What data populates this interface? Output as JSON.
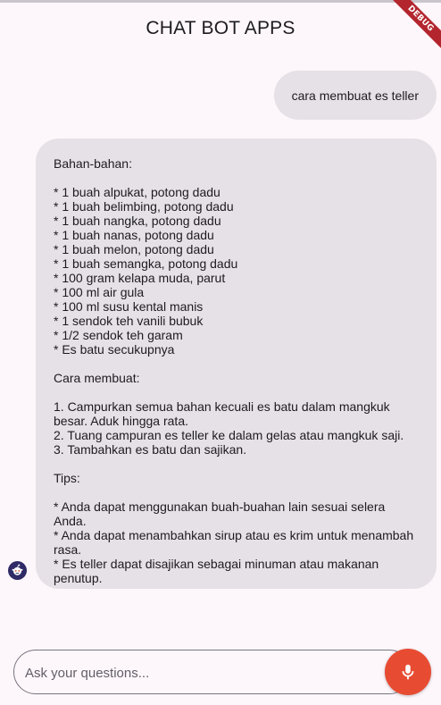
{
  "app": {
    "title": "CHAT BOT APPS",
    "debug_banner": "DEBUG"
  },
  "messages": [
    {
      "role": "user",
      "text": "cara membuat es teller"
    },
    {
      "role": "bot",
      "text": "Bahan-bahan:\n\n* 1 buah alpukat, potong dadu\n* 1 buah belimbing, potong dadu\n* 1 buah nangka, potong dadu\n* 1 buah nanas, potong dadu\n* 1 buah melon, potong dadu\n* 1 buah semangka, potong dadu\n* 100 gram kelapa muda, parut\n* 100 ml air gula\n* 100 ml susu kental manis\n* 1 sendok teh vanili bubuk\n* 1/2 sendok teh garam\n* Es batu secukupnya\n\nCara membuat:\n\n1. Campurkan semua bahan kecuali es batu dalam mangkuk\nbesar. Aduk hingga rata.\n2. Tuang campuran es teller ke dalam gelas atau mangkuk saji.\n3. Tambahkan es batu dan sajikan.\n\nTips:\n\n* Anda dapat menggunakan buah-buahan lain sesuai selera Anda.\n* Anda dapat menambahkan sirup atau es krim untuk menambah\nrasa.\n* Es teller dapat disajikan sebagai minuman atau makanan\npenutup."
    }
  ],
  "composer": {
    "placeholder": "Ask your questions...",
    "value": ""
  },
  "icons": {
    "bot_avatar": "bot-avatar-icon",
    "mic": "microphone-icon"
  },
  "colors": {
    "background": "#fdf7fc",
    "bubble": "#e6e1e6",
    "mic_button": "#e74c32",
    "debug_banner": "#b3262e"
  }
}
